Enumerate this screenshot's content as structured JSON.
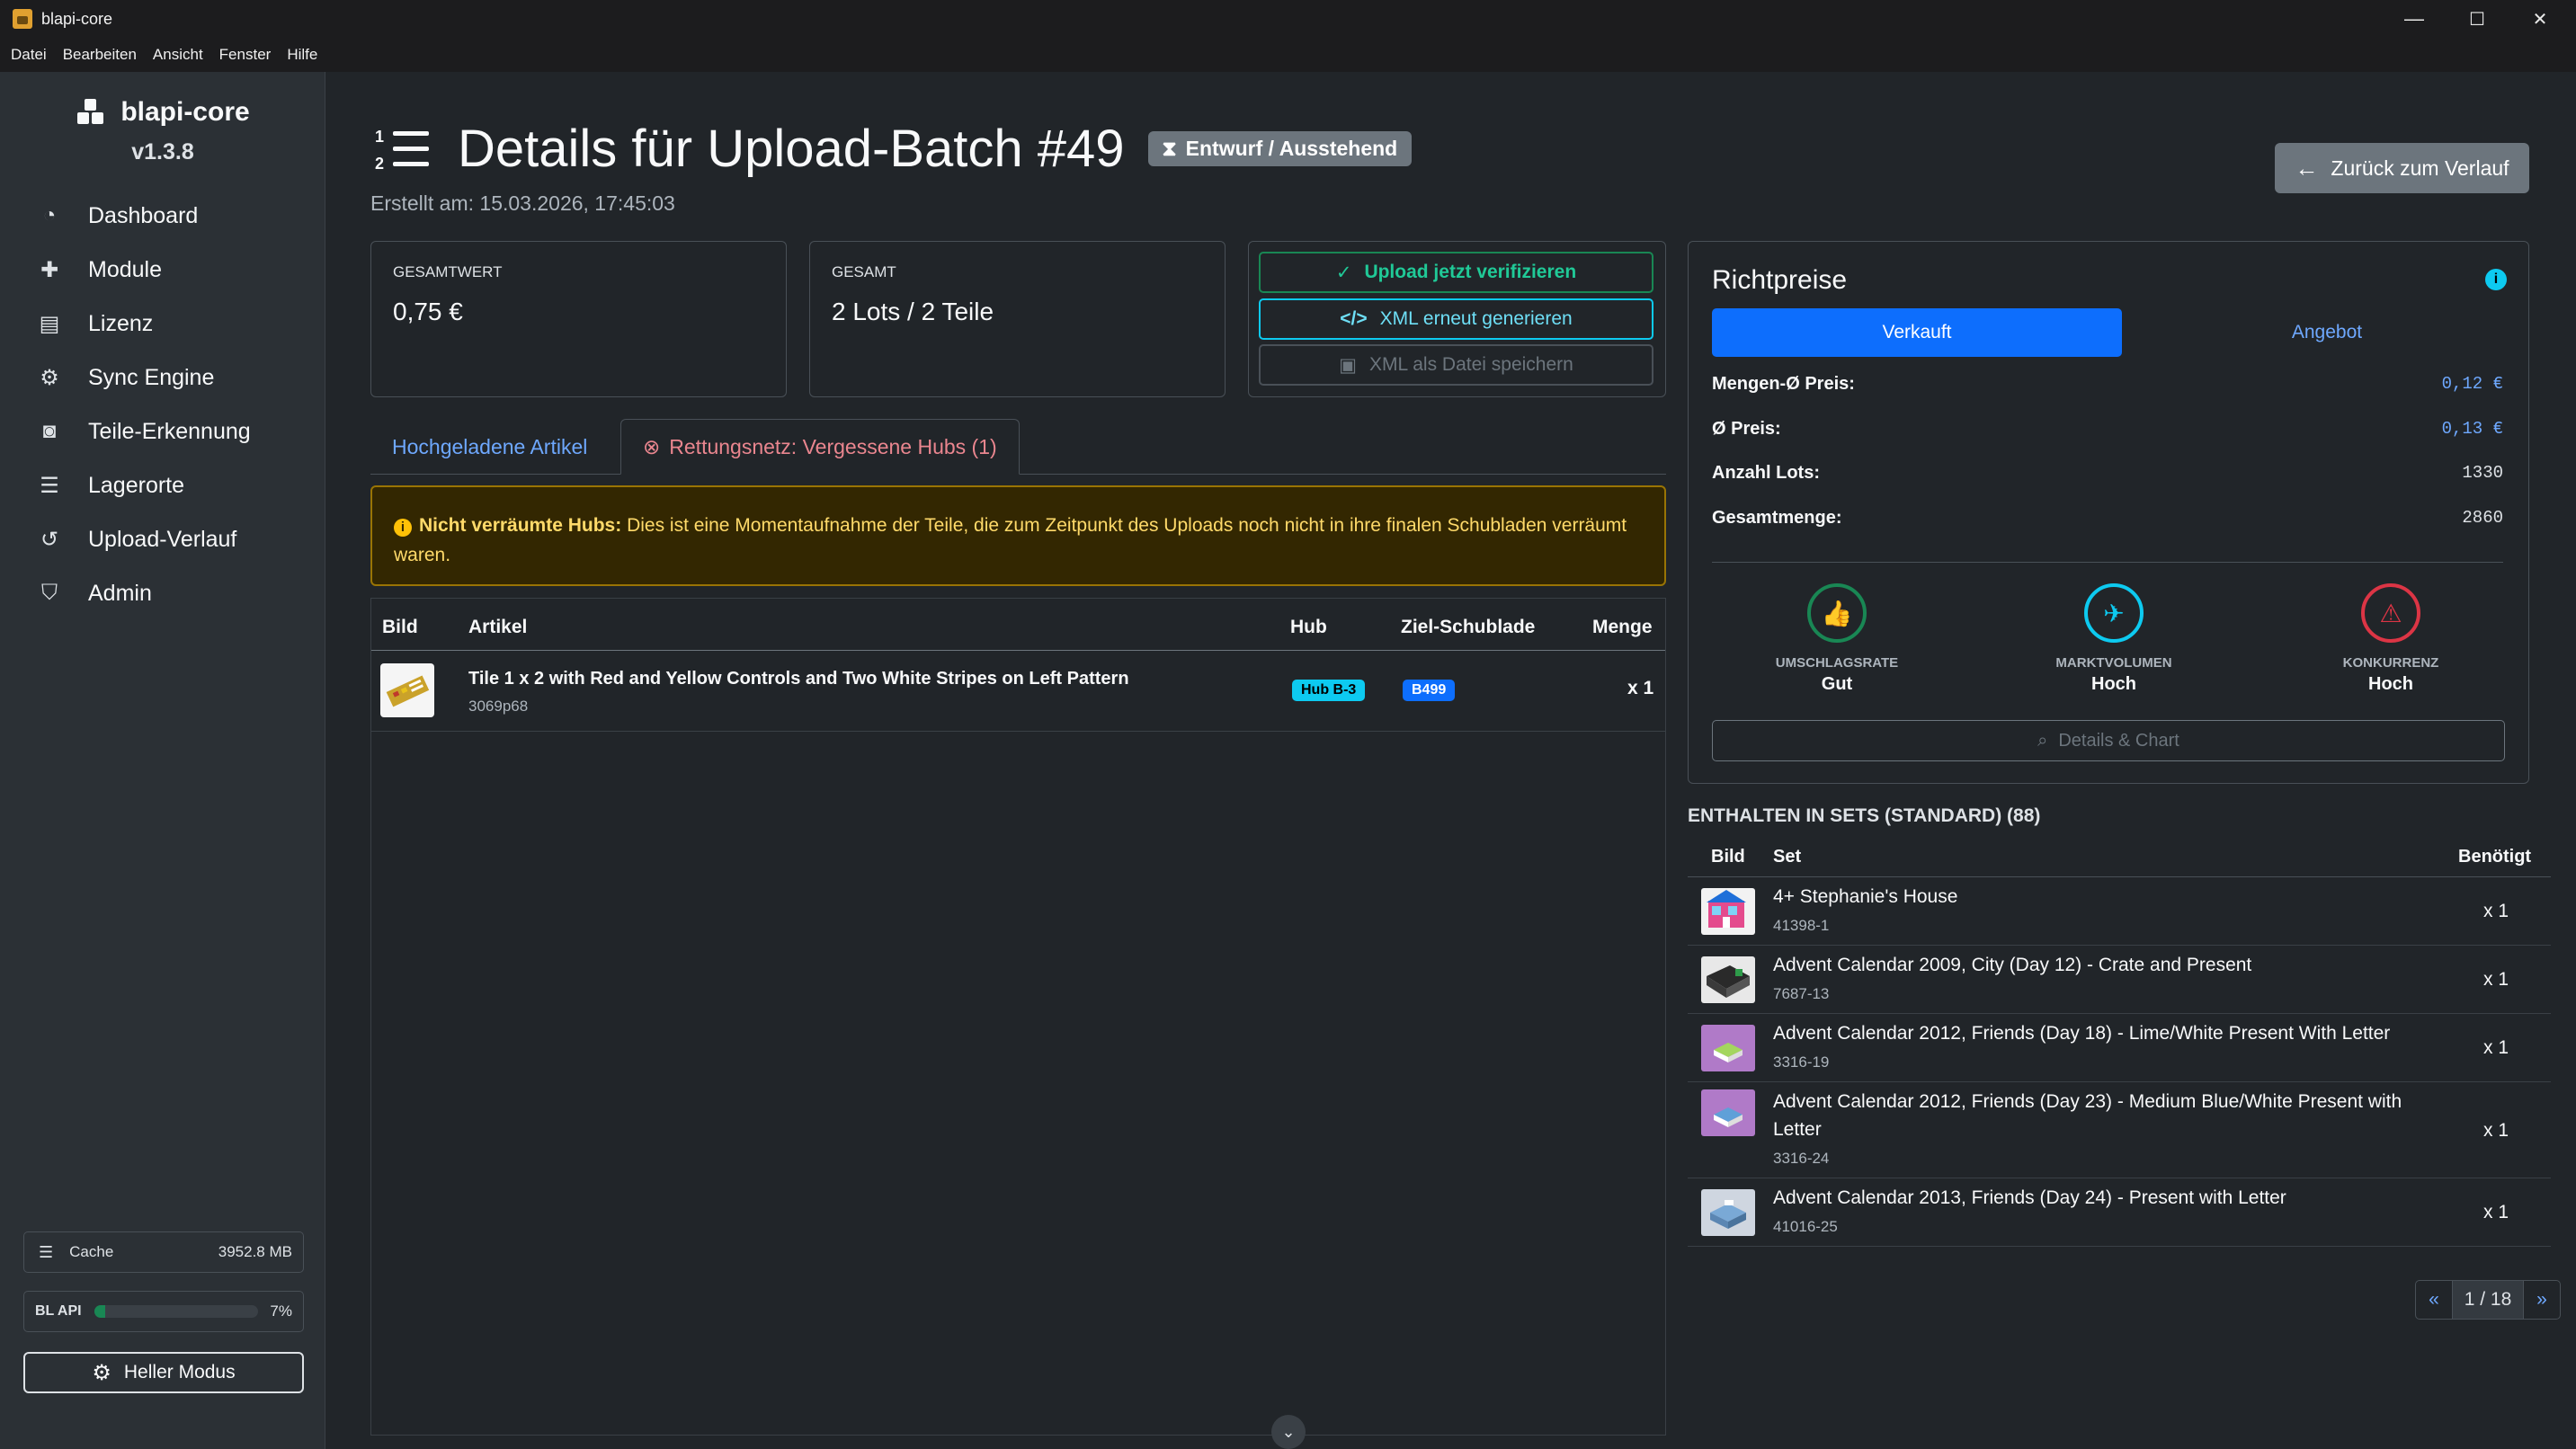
{
  "window": {
    "title": "blapi-core",
    "min": "—",
    "max": "☐",
    "close": "✕"
  },
  "menu": [
    "Datei",
    "Bearbeiten",
    "Ansicht",
    "Fenster",
    "Hilfe"
  ],
  "sidebar": {
    "brand": "blapi-core",
    "version": "v1.3.8",
    "items": [
      {
        "label": "Dashboard",
        "icon": "speedometer-icon"
      },
      {
        "label": "Module",
        "icon": "puzzle-icon"
      },
      {
        "label": "Lizenz",
        "icon": "license-icon"
      },
      {
        "label": "Sync Engine",
        "icon": "gears-icon"
      },
      {
        "label": "Teile-Erkennung",
        "icon": "camera-icon"
      },
      {
        "label": "Lagerorte",
        "icon": "storage-icon"
      },
      {
        "label": "Upload-Verlauf",
        "icon": "history-icon"
      },
      {
        "label": "Admin",
        "icon": "shield-icon"
      }
    ],
    "cache_label": "Cache",
    "cache_value": "3952.8 MB",
    "api_label": "BL API",
    "api_value": "7%",
    "api_percent": 7,
    "mode_button": "Heller Modus"
  },
  "header": {
    "title": "Details für Upload-Batch #49",
    "status": "Entwurf / Ausstehend",
    "created": "Erstellt am: 15.03.2026, 17:45:03",
    "back_button": "Zurück zum Verlauf"
  },
  "stats": {
    "total_value_label": "GESAMTWERT",
    "total_value": "0,75 €",
    "total_label": "GESAMT",
    "total": "2 Lots / 2 Teile"
  },
  "actions": {
    "verify": "Upload jetzt verifizieren",
    "regenerate": "XML erneut generieren",
    "save": "XML als Datei speichern"
  },
  "tabs": {
    "uploaded": "Hochgeladene Artikel",
    "rescue": "Rettungsnetz: Vergessene Hubs (1)"
  },
  "alert": {
    "title": "Nicht verräumte Hubs:",
    "text": "Dies ist eine Momentaufnahme der Teile, die zum Zeitpunkt des Uploads noch nicht in ihre finalen Schubladen verräumt waren."
  },
  "table": {
    "headers": [
      "Bild",
      "Artikel",
      "Hub",
      "Ziel-Schublade",
      "Menge"
    ],
    "rows": [
      {
        "name": "Tile 1 x 2 with Red and Yellow Controls and Two White Stripes on Left Pattern",
        "number": "3069p68",
        "hub": "Hub B-3",
        "drawer": "B499",
        "qty": "x 1"
      }
    ]
  },
  "prices": {
    "title": "Richtpreise",
    "tab_sold": "Verkauft",
    "tab_offer": "Angebot",
    "rows": [
      {
        "label": "Mengen-Ø Preis:",
        "value": "0,12 €"
      },
      {
        "label": "Ø Preis:",
        "value": "0,13 €"
      },
      {
        "label": "Anzahl Lots:",
        "value": "1330"
      },
      {
        "label": "Gesamtmenge:",
        "value": "2860"
      }
    ],
    "metrics": [
      {
        "label": "UMSCHLAGSRATE",
        "value": "Gut",
        "color": "#198754"
      },
      {
        "label": "MARKTVOLUMEN",
        "value": "Hoch",
        "color": "#0dcaf0"
      },
      {
        "label": "KONKURRENZ",
        "value": "Hoch",
        "color": "#dc3545"
      }
    ],
    "details_button": "Details & Chart"
  },
  "sets": {
    "title": "ENTHALTEN IN SETS (STANDARD) (88)",
    "headers": [
      "Bild",
      "Set",
      "Benötigt"
    ],
    "rows": [
      {
        "name": "4+ Stephanie's House",
        "number": "41398-1",
        "qty": "x 1"
      },
      {
        "name": "Advent Calendar 2009, City (Day 12) - Crate and Present",
        "number": "7687-13",
        "qty": "x 1"
      },
      {
        "name": "Advent Calendar 2012, Friends (Day 18) - Lime/White Present With Letter",
        "number": "3316-19",
        "qty": "x 1"
      },
      {
        "name": "Advent Calendar 2012, Friends (Day 23) - Medium Blue/White Present with Letter",
        "number": "3316-24",
        "qty": "x 1"
      },
      {
        "name": "Advent Calendar 2013, Friends (Day 24) - Present with Letter",
        "number": "41016-25",
        "qty": "x 1"
      }
    ],
    "pager": {
      "prev": "«",
      "page": "1 / 18",
      "next": "»"
    }
  }
}
